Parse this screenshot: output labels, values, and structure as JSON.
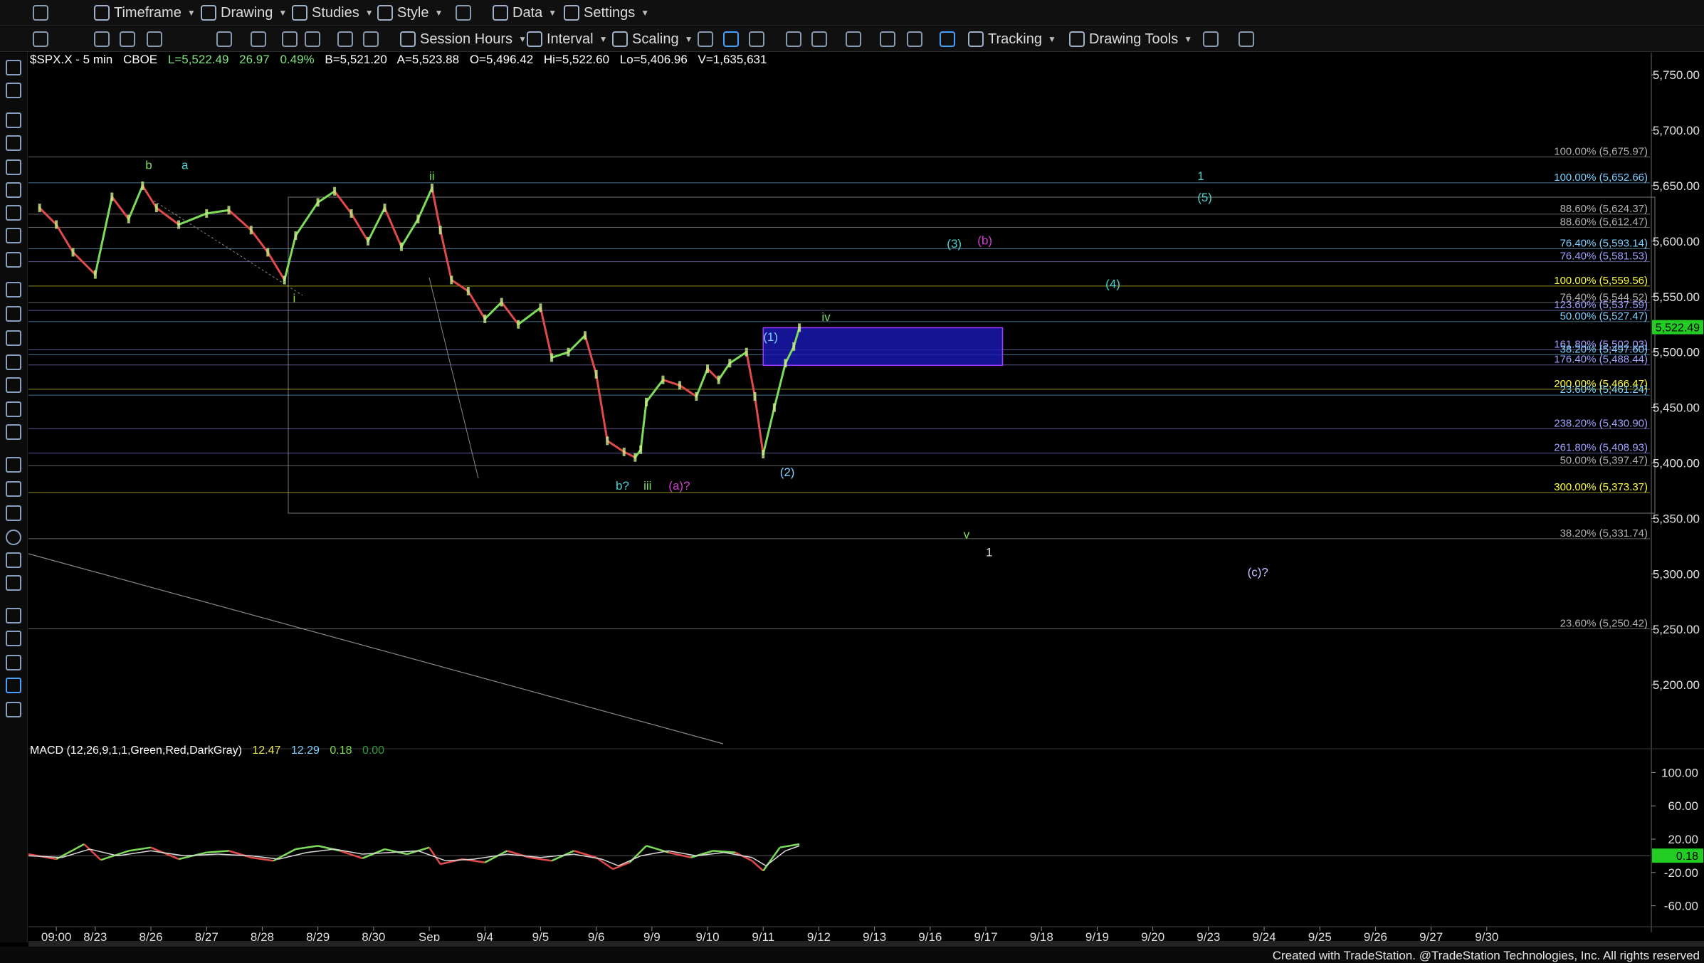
{
  "toolbar_top": {
    "timeframe": "Timeframe",
    "drawing": "Drawing",
    "studies": "Studies",
    "style": "Style",
    "data": "Data",
    "settings": "Settings"
  },
  "toolbar_bottom": {
    "session_hours": "Session Hours",
    "interval": "Interval",
    "scaling": "Scaling",
    "tracking": "Tracking",
    "drawing_tools": "Drawing Tools"
  },
  "symbol_bar": {
    "symbol": "$SPX.X - 5 min",
    "exchange": "CBOE",
    "last": "L=5,522.49",
    "change": "26.97",
    "change_pct": "0.49%",
    "bid": "B=5,521.20",
    "ask": "A=5,523.88",
    "open": "O=5,496.42",
    "high": "Hi=5,522.60",
    "low": "Lo=5,406.96",
    "volume": "V=1,635,631"
  },
  "macd_bar": {
    "label": "MACD (12,26,9,1,1,Green,Red,DarkGray)",
    "v1": "12.47",
    "v2": "12.29",
    "v3": "0.18",
    "v4": "0.00"
  },
  "footer_text": "Created with TradeStation. @TradeStation Technologies, Inc. All rights reserved",
  "colors": {
    "background": "#000000",
    "up": "#7ddc5a",
    "down": "#e04a4a",
    "signal": "#d8d8d8",
    "box": "#1a1ab8",
    "current_price": "#22cc22"
  },
  "chart_data": {
    "type": "line",
    "title": "$SPX.X - 5 min",
    "ylim": [
      5150,
      5770
    ],
    "price_ticks": [
      5750,
      5700,
      5650,
      5600,
      5550,
      5500,
      5450,
      5400,
      5350,
      5300,
      5250,
      5200
    ],
    "price_tick_labels": [
      "5,750.00",
      "5,700.00",
      "5,650.00",
      "5,600.00",
      "5,550.00",
      "5,500.00",
      "5,450.00",
      "5,400.00",
      "5,350.00",
      "5,300.00",
      "5,250.00",
      "5,200.00"
    ],
    "current_price_label": "5,522.49",
    "current_price": 5522.49,
    "x_labels": [
      "09:00",
      "8/23",
      "8/26",
      "8/27",
      "8/28",
      "8/29",
      "8/30",
      "Sep",
      "9/4",
      "9/5",
      "9/6",
      "9/9",
      "9/10",
      "9/11",
      "9/12",
      "9/13",
      "9/16",
      "9/17",
      "9/18",
      "9/19",
      "9/20",
      "9/23",
      "9/24",
      "9/25",
      "9/26",
      "9/27",
      "9/30"
    ],
    "x_label_positions": [
      0.5,
      1.2,
      2.2,
      3.2,
      4.2,
      5.2,
      6.2,
      7.2,
      8.2,
      9.2,
      10.2,
      11.2,
      12.2,
      13.2,
      14.2,
      15.2,
      16.2,
      17.2,
      18.2,
      19.2,
      20.2,
      21.2,
      22.2,
      23.2,
      24.2,
      25.2,
      26.2
    ],
    "price_path": [
      [
        0.2,
        5630
      ],
      [
        0.5,
        5615
      ],
      [
        0.8,
        5590
      ],
      [
        1.2,
        5570
      ],
      [
        1.5,
        5640
      ],
      [
        1.8,
        5620
      ],
      [
        2.05,
        5650
      ],
      [
        2.3,
        5630
      ],
      [
        2.7,
        5615
      ],
      [
        3.2,
        5625
      ],
      [
        3.6,
        5628
      ],
      [
        4.0,
        5610
      ],
      [
        4.3,
        5590
      ],
      [
        4.6,
        5565
      ],
      [
        4.8,
        5605
      ],
      [
        5.2,
        5635
      ],
      [
        5.5,
        5645
      ],
      [
        5.8,
        5625
      ],
      [
        6.1,
        5600
      ],
      [
        6.4,
        5630
      ],
      [
        6.7,
        5595
      ],
      [
        7.0,
        5620
      ],
      [
        7.25,
        5648
      ],
      [
        7.4,
        5610
      ],
      [
        7.6,
        5565
      ],
      [
        7.9,
        5555
      ],
      [
        8.2,
        5530
      ],
      [
        8.5,
        5545
      ],
      [
        8.8,
        5525
      ],
      [
        9.2,
        5540
      ],
      [
        9.4,
        5495
      ],
      [
        9.7,
        5500
      ],
      [
        10.0,
        5515
      ],
      [
        10.2,
        5480
      ],
      [
        10.4,
        5420
      ],
      [
        10.7,
        5410
      ],
      [
        10.9,
        5405
      ],
      [
        11.0,
        5412
      ],
      [
        11.1,
        5455
      ],
      [
        11.4,
        5475
      ],
      [
        11.7,
        5470
      ],
      [
        12.0,
        5460
      ],
      [
        12.2,
        5485
      ],
      [
        12.4,
        5475
      ],
      [
        12.6,
        5490
      ],
      [
        12.9,
        5500
      ],
      [
        13.05,
        5460
      ],
      [
        13.2,
        5408
      ],
      [
        13.4,
        5450
      ],
      [
        13.6,
        5490
      ],
      [
        13.75,
        5505
      ],
      [
        13.85,
        5522
      ]
    ],
    "macd_ylim": [
      -80,
      120
    ],
    "macd_ticks": [
      100,
      60,
      20,
      -20,
      -60
    ],
    "macd_tick_labels": [
      "100.00",
      "60.00",
      "20.00",
      "-20.00",
      "-60.00"
    ],
    "macd_current_label": "0.18",
    "macd_current": 0.18,
    "macd_path": [
      [
        0.0,
        2
      ],
      [
        0.5,
        -4
      ],
      [
        1.0,
        14
      ],
      [
        1.3,
        -5
      ],
      [
        1.8,
        6
      ],
      [
        2.2,
        10
      ],
      [
        2.7,
        -4
      ],
      [
        3.2,
        4
      ],
      [
        3.6,
        6
      ],
      [
        4.0,
        -2
      ],
      [
        4.4,
        -6
      ],
      [
        4.8,
        8
      ],
      [
        5.2,
        12
      ],
      [
        5.6,
        6
      ],
      [
        6.0,
        -3
      ],
      [
        6.4,
        8
      ],
      [
        6.8,
        2
      ],
      [
        7.2,
        10
      ],
      [
        7.4,
        -10
      ],
      [
        7.8,
        -4
      ],
      [
        8.2,
        -8
      ],
      [
        8.6,
        6
      ],
      [
        9.0,
        -2
      ],
      [
        9.4,
        -6
      ],
      [
        9.8,
        6
      ],
      [
        10.2,
        -2
      ],
      [
        10.5,
        -16
      ],
      [
        10.8,
        -8
      ],
      [
        11.1,
        12
      ],
      [
        11.5,
        4
      ],
      [
        11.9,
        -2
      ],
      [
        12.3,
        6
      ],
      [
        12.7,
        4
      ],
      [
        13.0,
        -6
      ],
      [
        13.2,
        -18
      ],
      [
        13.5,
        10
      ],
      [
        13.85,
        14
      ]
    ],
    "macd_signal_path": [
      [
        0.0,
        0
      ],
      [
        0.6,
        -2
      ],
      [
        1.1,
        8
      ],
      [
        1.6,
        0
      ],
      [
        2.2,
        6
      ],
      [
        2.8,
        0
      ],
      [
        3.4,
        2
      ],
      [
        4.0,
        0
      ],
      [
        4.5,
        -4
      ],
      [
        5.0,
        4
      ],
      [
        5.5,
        8
      ],
      [
        6.0,
        2
      ],
      [
        6.5,
        4
      ],
      [
        7.0,
        6
      ],
      [
        7.5,
        -6
      ],
      [
        8.0,
        -4
      ],
      [
        8.6,
        2
      ],
      [
        9.2,
        -2
      ],
      [
        9.8,
        2
      ],
      [
        10.3,
        -4
      ],
      [
        10.6,
        -12
      ],
      [
        11.0,
        0
      ],
      [
        11.5,
        6
      ],
      [
        12.0,
        0
      ],
      [
        12.5,
        4
      ],
      [
        13.0,
        -2
      ],
      [
        13.25,
        -12
      ],
      [
        13.6,
        6
      ],
      [
        13.85,
        12
      ]
    ],
    "fib_levels": [
      {
        "label": "100.00% (5,675.97)",
        "value": 5675.97,
        "color": "#b0b0b0"
      },
      {
        "label": "100.00% (5,652.66)",
        "value": 5652.66,
        "color": "#7fd0ff"
      },
      {
        "label": "88.60% (5,624.37)",
        "value": 5624.37,
        "color": "#b0b0b0"
      },
      {
        "label": "88.60% (5,612.47)",
        "value": 5612.47,
        "color": "#b0b0b0"
      },
      {
        "label": "76.40% (5,593.14)",
        "value": 5593.14,
        "color": "#7fd0ff"
      },
      {
        "label": "76.40% (5,581.53)",
        "value": 5581.53,
        "color": "#a0a0ff"
      },
      {
        "label": "100.00% (5,559.56)",
        "value": 5559.56,
        "color": "#ffff40"
      },
      {
        "label": "76.40% (5,544.52)",
        "value": 5544.52,
        "color": "#b0b0b0"
      },
      {
        "label": "123.60% (5,537.59)",
        "value": 5537.59,
        "color": "#a0a0ff"
      },
      {
        "label": "50.00% (5,527.47)",
        "value": 5527.47,
        "color": "#7fd0ff"
      },
      {
        "label": "161.80% (5,502.03)",
        "value": 5502.03,
        "color": "#a0a0ff"
      },
      {
        "label": "38.20% (5,497.60)",
        "value": 5497.6,
        "color": "#7fd0ff"
      },
      {
        "label": "176.40% (5,488.44)",
        "value": 5488.44,
        "color": "#a0a0ff"
      },
      {
        "label": "200.00% (5,466.47)",
        "value": 5466.47,
        "color": "#ffff40"
      },
      {
        "label": "23.60% (5,461.24)",
        "value": 5461.24,
        "color": "#7fd0ff"
      },
      {
        "label": "238.20% (5,430.90)",
        "value": 5430.9,
        "color": "#a0a0ff"
      },
      {
        "label": "261.80% (5,408.93)",
        "value": 5408.93,
        "color": "#a0a0ff"
      },
      {
        "label": "50.00% (5,397.47)",
        "value": 5397.47,
        "color": "#b0b0b0"
      },
      {
        "label": "300.00% (5,373.37)",
        "value": 5373.37,
        "color": "#ffff40"
      },
      {
        "label": "38.20% (5,331.74)",
        "value": 5331.74,
        "color": "#b0b0b0"
      },
      {
        "label": "23.60% (5,250.42)",
        "value": 5250.42,
        "color": "#b0b0b0"
      }
    ],
    "annotations": [
      {
        "text": "b",
        "x": 2.1,
        "y": 5665,
        "color": "#7ddc5a"
      },
      {
        "text": "a",
        "x": 2.75,
        "y": 5665,
        "color": "#4fd0d0"
      },
      {
        "text": "ii",
        "x": 7.2,
        "y": 5655,
        "color": "#7ddc5a"
      },
      {
        "text": "i",
        "x": 4.75,
        "y": 5545,
        "color": "#7ddc5a"
      },
      {
        "text": "b?",
        "x": 10.55,
        "y": 5376,
        "color": "#4fd0d0"
      },
      {
        "text": "iii",
        "x": 11.05,
        "y": 5376,
        "color": "#7ddc5a"
      },
      {
        "text": "(a)?",
        "x": 11.5,
        "y": 5376,
        "color": "#d040d0"
      },
      {
        "text": "(1)",
        "x": 13.2,
        "y": 5510,
        "color": "#7fd0ff"
      },
      {
        "text": "(2)",
        "x": 13.5,
        "y": 5388,
        "color": "#7fd0ff"
      },
      {
        "text": "iv",
        "x": 14.25,
        "y": 5528,
        "color": "#7ddc5a"
      },
      {
        "text": "(3)",
        "x": 16.5,
        "y": 5594,
        "color": "#4fd0d0"
      },
      {
        "text": "(b)",
        "x": 17.05,
        "y": 5597,
        "color": "#d040d0"
      },
      {
        "text": "(4)",
        "x": 19.35,
        "y": 5558,
        "color": "#4fd0d0"
      },
      {
        "text": "1",
        "x": 21.0,
        "y": 5655,
        "color": "#4fd0d0"
      },
      {
        "text": "(5)",
        "x": 21.0,
        "y": 5636,
        "color": "#4fd0d0"
      },
      {
        "text": "v",
        "x": 16.8,
        "y": 5332,
        "color": "#7ddc5a"
      },
      {
        "text": "1",
        "x": 17.2,
        "y": 5316,
        "color": "#e0e0e0"
      },
      {
        "text": "(c)?",
        "x": 21.9,
        "y": 5298,
        "color": "#c0c0ff"
      }
    ],
    "target_box": {
      "x0": 13.2,
      "x1": 17.5,
      "y0": 5488,
      "y1": 5522
    },
    "grid": false
  }
}
